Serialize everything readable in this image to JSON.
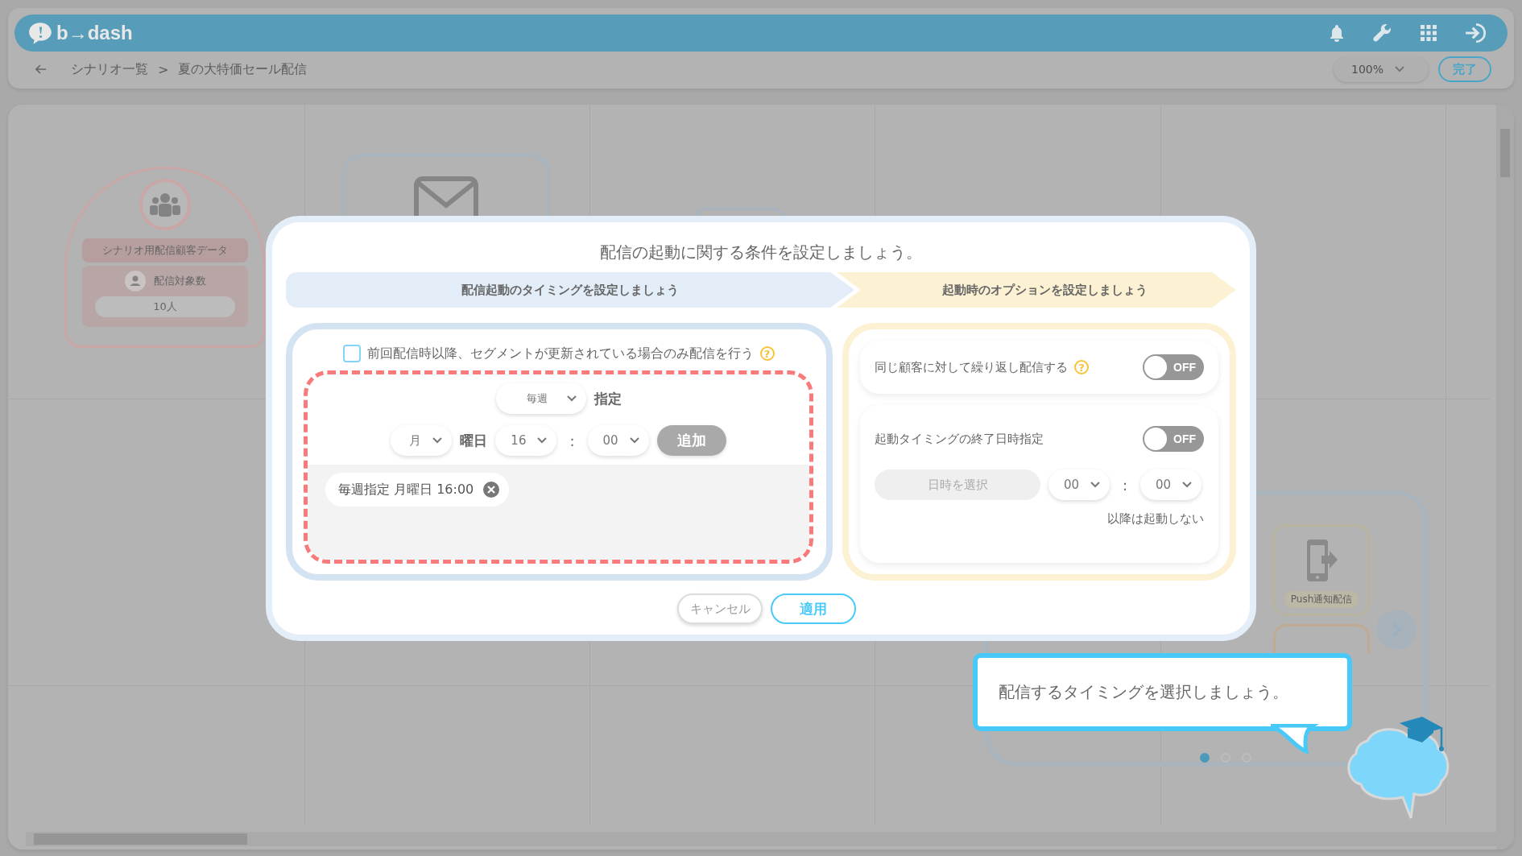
{
  "header": {
    "logo": "b→dash"
  },
  "breadcrumb": {
    "items": [
      "シナリオ一覧",
      "夏の大特価セール配信"
    ],
    "separator": ">"
  },
  "zoom_select": {
    "value": "100%"
  },
  "done_button": "完了",
  "canvas": {
    "segment_node": {
      "title": "シナリオ用配信顧客データ",
      "count_label": "配信対象数",
      "count": "10人"
    },
    "palette": {
      "items": [
        {
          "kind": "push",
          "label": "Push通知配信"
        }
      ],
      "page_dots": [
        {
          "selected": true
        },
        {
          "selected": false
        },
        {
          "selected": false
        }
      ]
    }
  },
  "dialog": {
    "title": "配信の起動に関する条件を設定しましょう。",
    "steps": [
      {
        "label": "配信起動のタイミングを設定しましょう",
        "color": "#e2edf7"
      },
      {
        "label": "起動時のオプションを設定しましょう",
        "color": "#fcf1d3"
      }
    ],
    "timing": {
      "segment_check": {
        "label": "前回配信時以降、セグメントが更新されている場合のみ配信を行う",
        "checked": false,
        "help": "?"
      },
      "frequency": {
        "value": "毎週",
        "suffix": "指定"
      },
      "weekday": {
        "value": "月",
        "suffix": "曜日"
      },
      "hour": "16",
      "separator": ":",
      "minute": "00",
      "add_button": {
        "label": "追加",
        "disabled": true
      },
      "schedules": [
        {
          "label": "毎週指定 月曜日 16:00"
        }
      ]
    },
    "options": [
      {
        "kind": "toggle",
        "label": "同じ顧客に対して繰り返し配信する",
        "help": "?",
        "on": false,
        "toggle_text": "OFF"
      },
      {
        "kind": "end_date",
        "label": "起動タイミングの終了日時指定",
        "on": false,
        "toggle_text": "OFF",
        "date": {
          "placeholder": "日時を選択",
          "disabled": true
        },
        "hour": "00",
        "separator": ":",
        "minute": "00",
        "note": "以降は起動しない"
      }
    ],
    "cancel_button": "キャンセル",
    "apply_button": "適用"
  },
  "guide_bubble": {
    "text": "配信するタイミングを選択しましょう。"
  }
}
